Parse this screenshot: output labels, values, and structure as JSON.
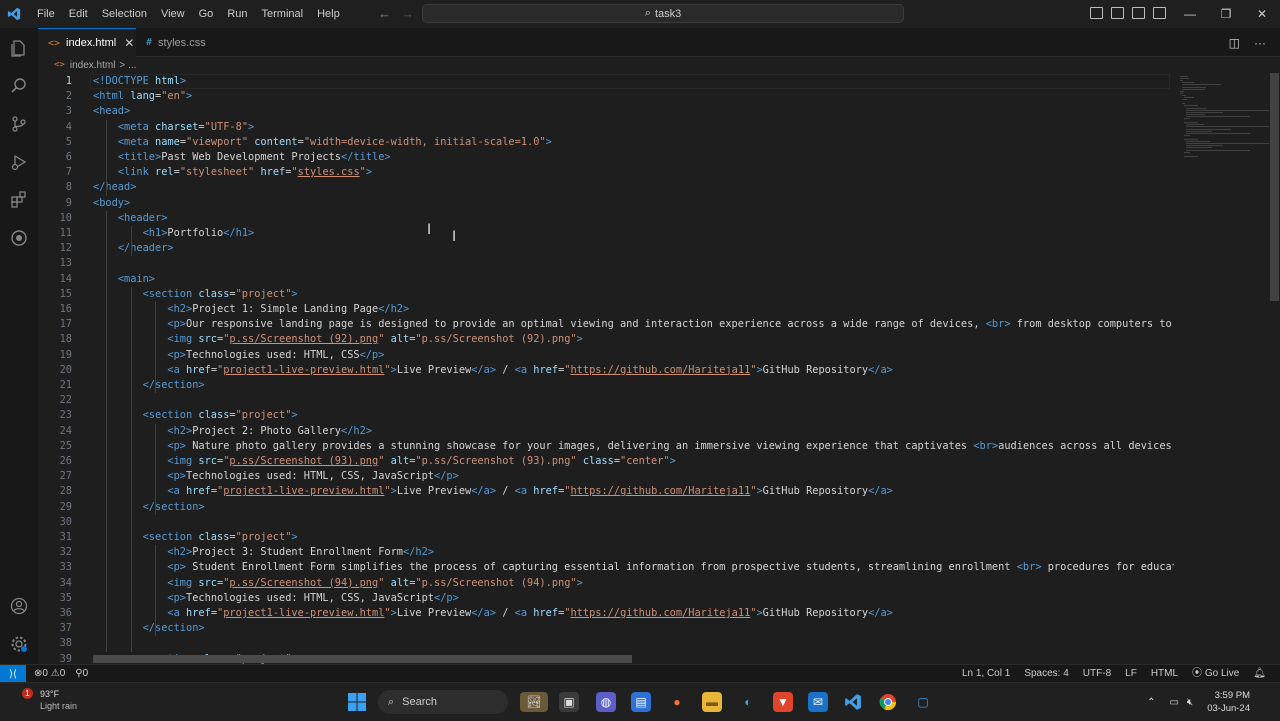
{
  "titlebar": {
    "menu": [
      "File",
      "Edit",
      "Selection",
      "View",
      "Go",
      "Run",
      "Terminal",
      "Help"
    ],
    "search_text": "task3"
  },
  "tabs": [
    {
      "label": "index.html",
      "icon": "html-icon"
    },
    {
      "label": "styles.css",
      "icon": "css-icon"
    }
  ],
  "breadcrumb": {
    "file": "index.html",
    "rest": "> ..."
  },
  "editor": {
    "current_line": 1,
    "lines": [
      [
        [
          "t",
          "<!DOCTYPE "
        ],
        [
          "a",
          "html"
        ],
        [
          "t",
          ">"
        ]
      ],
      [
        [
          "t",
          "<html "
        ],
        [
          "a",
          "lang"
        ],
        [
          "x",
          "="
        ],
        [
          "s",
          "\"en\""
        ],
        [
          "t",
          ">"
        ]
      ],
      [
        [
          "t",
          "<head>"
        ]
      ],
      [
        [
          "x",
          "    "
        ],
        [
          "t",
          "<meta "
        ],
        [
          "a",
          "charset"
        ],
        [
          "x",
          "="
        ],
        [
          "s",
          "\"UTF-8\""
        ],
        [
          "t",
          ">"
        ]
      ],
      [
        [
          "x",
          "    "
        ],
        [
          "t",
          "<meta "
        ],
        [
          "a",
          "name"
        ],
        [
          "x",
          "="
        ],
        [
          "s",
          "\"viewport\""
        ],
        [
          "x",
          " "
        ],
        [
          "a",
          "content"
        ],
        [
          "x",
          "="
        ],
        [
          "s",
          "\"width=device-width, initial-scale=1.0\""
        ],
        [
          "t",
          ">"
        ]
      ],
      [
        [
          "x",
          "    "
        ],
        [
          "t",
          "<title>"
        ],
        [
          "x",
          "Past Web Development Projects"
        ],
        [
          "t",
          "</title>"
        ]
      ],
      [
        [
          "x",
          "    "
        ],
        [
          "t",
          "<link "
        ],
        [
          "a",
          "rel"
        ],
        [
          "x",
          "="
        ],
        [
          "s",
          "\"stylesheet\""
        ],
        [
          "x",
          " "
        ],
        [
          "a",
          "href"
        ],
        [
          "x",
          "="
        ],
        [
          "s",
          "\""
        ],
        [
          "u",
          "styles.css"
        ],
        [
          "s",
          "\""
        ],
        [
          "t",
          ">"
        ]
      ],
      [
        [
          "t",
          "</head>"
        ]
      ],
      [
        [
          "t",
          "<body>"
        ]
      ],
      [
        [
          "x",
          "    "
        ],
        [
          "t",
          "<header>"
        ]
      ],
      [
        [
          "x",
          "        "
        ],
        [
          "t",
          "<h1>"
        ],
        [
          "x",
          "Portfolio"
        ],
        [
          "t",
          "</h1>"
        ]
      ],
      [
        [
          "x",
          "    "
        ],
        [
          "t",
          "</header>"
        ]
      ],
      [],
      [
        [
          "x",
          "    "
        ],
        [
          "t",
          "<main>"
        ]
      ],
      [
        [
          "x",
          "        "
        ],
        [
          "t",
          "<section "
        ],
        [
          "a",
          "class"
        ],
        [
          "x",
          "="
        ],
        [
          "s",
          "\"project\""
        ],
        [
          "t",
          ">"
        ]
      ],
      [
        [
          "x",
          "            "
        ],
        [
          "t",
          "<h2>"
        ],
        [
          "x",
          "Project 1: Simple Landing Page"
        ],
        [
          "t",
          "</h2>"
        ]
      ],
      [
        [
          "x",
          "            "
        ],
        [
          "t",
          "<p>"
        ],
        [
          "x",
          "Our responsive landing page is designed to provide an optimal viewing and interaction experience across a wide range of devices, "
        ],
        [
          "t",
          "<br>"
        ],
        [
          "x",
          " from desktop computers to m"
        ]
      ],
      [
        [
          "x",
          "            "
        ],
        [
          "t",
          "<img "
        ],
        [
          "a",
          "src"
        ],
        [
          "x",
          "="
        ],
        [
          "s",
          "\""
        ],
        [
          "u",
          "p.ss/Screenshot (92).png"
        ],
        [
          "s",
          "\""
        ],
        [
          "x",
          " "
        ],
        [
          "a",
          "alt"
        ],
        [
          "x",
          "="
        ],
        [
          "s",
          "\"p.ss/Screenshot (92).png\""
        ],
        [
          "t",
          ">"
        ]
      ],
      [
        [
          "x",
          "            "
        ],
        [
          "t",
          "<p>"
        ],
        [
          "x",
          "Technologies used: HTML, CSS"
        ],
        [
          "t",
          "</p>"
        ]
      ],
      [
        [
          "x",
          "            "
        ],
        [
          "t",
          "<a "
        ],
        [
          "a",
          "href"
        ],
        [
          "x",
          "="
        ],
        [
          "s",
          "\""
        ],
        [
          "u",
          "project1-live-preview.html"
        ],
        [
          "s",
          "\""
        ],
        [
          "t",
          ">"
        ],
        [
          "x",
          "Live Preview"
        ],
        [
          "t",
          "</a>"
        ],
        [
          "x",
          " / "
        ],
        [
          "t",
          "<a "
        ],
        [
          "a",
          "href"
        ],
        [
          "x",
          "="
        ],
        [
          "s",
          "\""
        ],
        [
          "u",
          "https://github.com/Hariteja11"
        ],
        [
          "s",
          "\""
        ],
        [
          "t",
          ">"
        ],
        [
          "x",
          "GitHub Repository"
        ],
        [
          "t",
          "</a>"
        ]
      ],
      [
        [
          "x",
          "        "
        ],
        [
          "t",
          "</section>"
        ]
      ],
      [],
      [
        [
          "x",
          "        "
        ],
        [
          "t",
          "<section "
        ],
        [
          "a",
          "class"
        ],
        [
          "x",
          "="
        ],
        [
          "s",
          "\"project\""
        ],
        [
          "t",
          ">"
        ]
      ],
      [
        [
          "x",
          "            "
        ],
        [
          "t",
          "<h2>"
        ],
        [
          "x",
          "Project 2: Photo Gallery"
        ],
        [
          "t",
          "</h2>"
        ]
      ],
      [
        [
          "x",
          "            "
        ],
        [
          "t",
          "<p>"
        ],
        [
          "x",
          " Nature photo gallery provides a stunning showcase for your images, delivering an immersive viewing experience that captivates "
        ],
        [
          "t",
          "<br>"
        ],
        [
          "x",
          "audiences across all devices."
        ]
      ],
      [
        [
          "x",
          "            "
        ],
        [
          "t",
          "<img "
        ],
        [
          "a",
          "src"
        ],
        [
          "x",
          "="
        ],
        [
          "s",
          "\""
        ],
        [
          "u",
          "p.ss/Screenshot (93).png"
        ],
        [
          "s",
          "\""
        ],
        [
          "x",
          " "
        ],
        [
          "a",
          "alt"
        ],
        [
          "x",
          "="
        ],
        [
          "s",
          "\"p.ss/Screenshot (93).png\""
        ],
        [
          "x",
          " "
        ],
        [
          "a",
          "class"
        ],
        [
          "x",
          "="
        ],
        [
          "s",
          "\"center\""
        ],
        [
          "t",
          ">"
        ]
      ],
      [
        [
          "x",
          "            "
        ],
        [
          "t",
          "<p>"
        ],
        [
          "x",
          "Technologies used: HTML, CSS, JavaScript"
        ],
        [
          "t",
          "</p>"
        ]
      ],
      [
        [
          "x",
          "            "
        ],
        [
          "t",
          "<a "
        ],
        [
          "a",
          "href"
        ],
        [
          "x",
          "="
        ],
        [
          "s",
          "\""
        ],
        [
          "u",
          "project1-live-preview.html"
        ],
        [
          "s",
          "\""
        ],
        [
          "t",
          ">"
        ],
        [
          "x",
          "Live Preview"
        ],
        [
          "t",
          "</a>"
        ],
        [
          "x",
          " / "
        ],
        [
          "t",
          "<a "
        ],
        [
          "a",
          "href"
        ],
        [
          "x",
          "="
        ],
        [
          "s",
          "\""
        ],
        [
          "u",
          "https://github.com/Hariteja11"
        ],
        [
          "s",
          "\""
        ],
        [
          "t",
          ">"
        ],
        [
          "x",
          "GitHub Repository"
        ],
        [
          "t",
          "</a>"
        ]
      ],
      [
        [
          "x",
          "        "
        ],
        [
          "t",
          "</section>"
        ]
      ],
      [],
      [
        [
          "x",
          "        "
        ],
        [
          "t",
          "<section "
        ],
        [
          "a",
          "class"
        ],
        [
          "x",
          "="
        ],
        [
          "s",
          "\"project\""
        ],
        [
          "t",
          ">"
        ]
      ],
      [
        [
          "x",
          "            "
        ],
        [
          "t",
          "<h2>"
        ],
        [
          "x",
          "Project 3: Student Enrollment Form"
        ],
        [
          "t",
          "</h2>"
        ]
      ],
      [
        [
          "x",
          "            "
        ],
        [
          "t",
          "<p>"
        ],
        [
          "x",
          " Student Enrollment Form simplifies the process of capturing essential information from prospective students, streamlining enrollment "
        ],
        [
          "t",
          "<br>"
        ],
        [
          "x",
          " procedures for educat"
        ]
      ],
      [
        [
          "x",
          "            "
        ],
        [
          "t",
          "<img "
        ],
        [
          "a",
          "src"
        ],
        [
          "x",
          "="
        ],
        [
          "s",
          "\""
        ],
        [
          "u",
          "p.ss/Screenshot (94).png"
        ],
        [
          "s",
          "\""
        ],
        [
          "x",
          " "
        ],
        [
          "a",
          "alt"
        ],
        [
          "x",
          "="
        ],
        [
          "s",
          "\"p.ss/Screenshot (94).png\""
        ],
        [
          "t",
          ">"
        ]
      ],
      [
        [
          "x",
          "            "
        ],
        [
          "t",
          "<p>"
        ],
        [
          "x",
          "Technologies used: HTML, CSS, JavaScript"
        ],
        [
          "t",
          "</p>"
        ]
      ],
      [
        [
          "x",
          "            "
        ],
        [
          "t",
          "<a "
        ],
        [
          "a",
          "href"
        ],
        [
          "x",
          "="
        ],
        [
          "s",
          "\""
        ],
        [
          "u",
          "project1-live-preview.html"
        ],
        [
          "s",
          "\""
        ],
        [
          "t",
          ">"
        ],
        [
          "x",
          "Live Preview"
        ],
        [
          "t",
          "</a>"
        ],
        [
          "x",
          " / "
        ],
        [
          "t",
          "<a "
        ],
        [
          "a",
          "href"
        ],
        [
          "x",
          "="
        ],
        [
          "s",
          "\""
        ],
        [
          "u",
          "https://github.com/Hariteja11"
        ],
        [
          "s",
          "\""
        ],
        [
          "t",
          ">"
        ],
        [
          "x",
          "GitHub Repository"
        ],
        [
          "t",
          "</a>"
        ]
      ],
      [
        [
          "x",
          "        "
        ],
        [
          "t",
          "</section>"
        ]
      ],
      [],
      [
        [
          "x",
          "        "
        ],
        [
          "t",
          "<section "
        ],
        [
          "a",
          "class"
        ],
        [
          "x",
          "="
        ],
        [
          "s",
          "\"project\""
        ],
        [
          "t",
          ">"
        ]
      ]
    ]
  },
  "statusbar": {
    "errors": "0",
    "warnings": "0",
    "ports": "0",
    "position": "Ln 1, Col 1",
    "spaces": "Spaces: 4",
    "encoding": "UTF-8",
    "eol": "LF",
    "language": "HTML",
    "golive": "Go Live"
  },
  "taskbar": {
    "weather_temp": "93°F",
    "weather_cond": "Light rain",
    "weather_badge": "1",
    "search": "Search",
    "time": "3:59 PM",
    "date": "03-Jun-24"
  }
}
